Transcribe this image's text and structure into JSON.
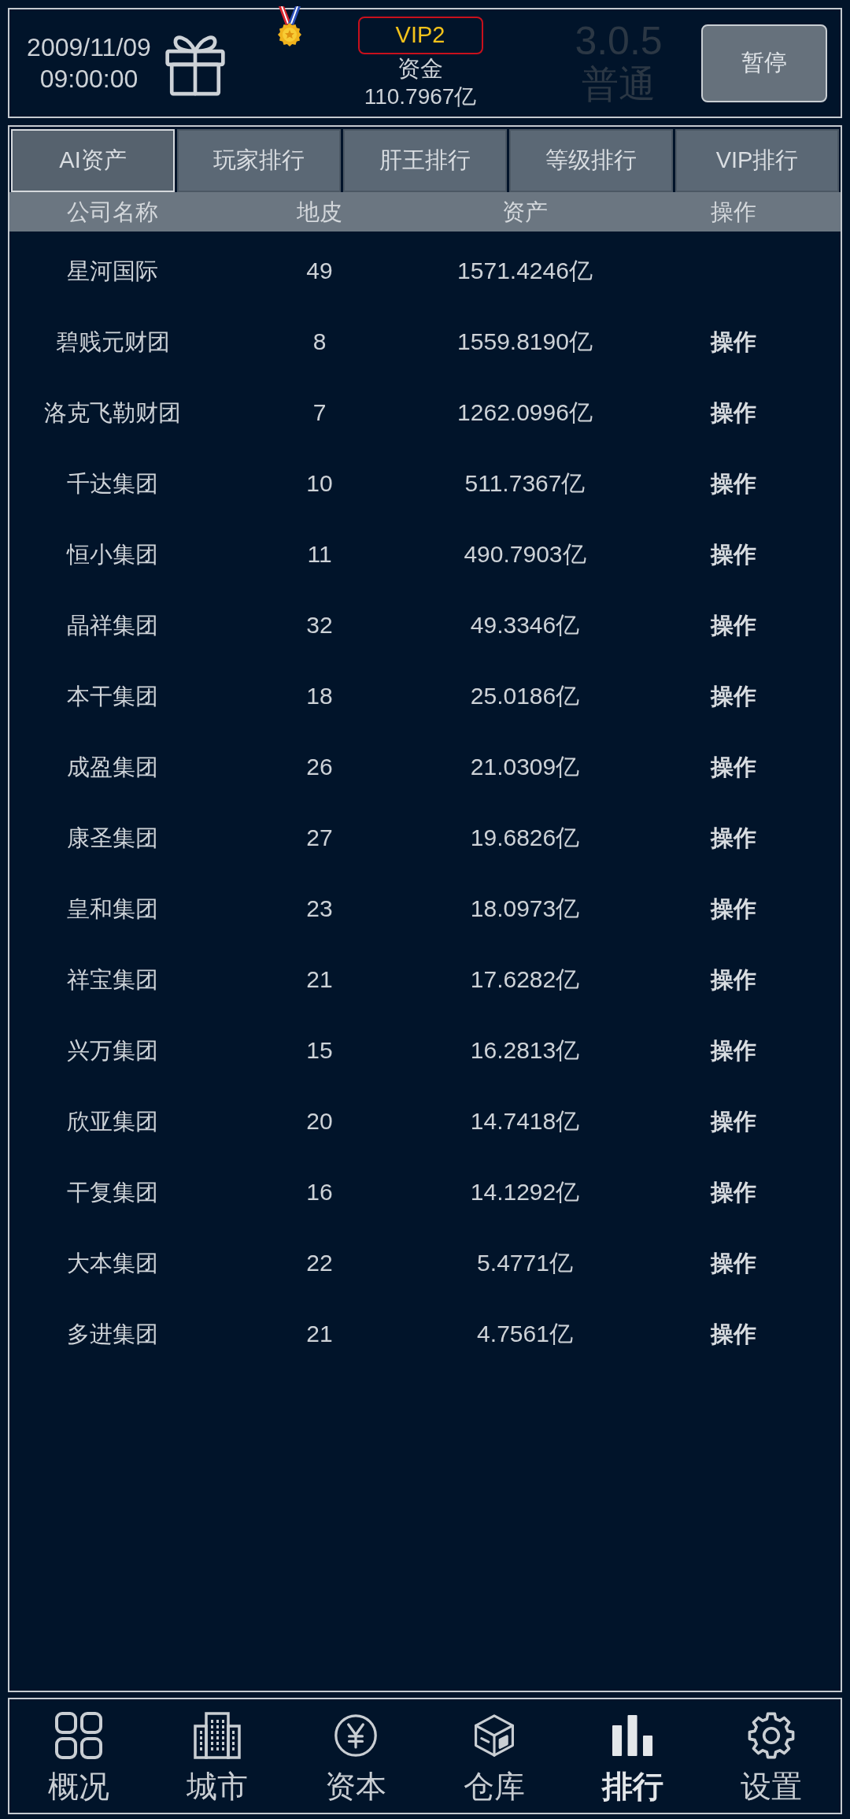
{
  "header": {
    "date": "2009/11/09",
    "time": "09:00:00",
    "vip_level": "VIP2",
    "funds_label": "资金",
    "funds_value": "110.7967亿",
    "version": "3.0.5",
    "mode": "普通",
    "pause_button": "暂停"
  },
  "tabs": [
    {
      "label": "AI资产",
      "selected": true
    },
    {
      "label": "玩家排行",
      "selected": false
    },
    {
      "label": "肝王排行",
      "selected": false
    },
    {
      "label": "等级排行",
      "selected": false
    },
    {
      "label": "VIP排行",
      "selected": false
    }
  ],
  "table": {
    "columns": [
      "公司名称",
      "地皮",
      "资产",
      "操作"
    ],
    "rows": [
      {
        "name": "星河国际",
        "land": "49",
        "assets": "1571.4246亿"
      },
      {
        "name": "碧贱元财团",
        "land": "8",
        "assets": "1559.8190亿",
        "action": "操作"
      },
      {
        "name": "洛克飞勒财团",
        "land": "7",
        "assets": "1262.0996亿",
        "action": "操作"
      },
      {
        "name": "千达集团",
        "land": "10",
        "assets": "511.7367亿",
        "action": "操作"
      },
      {
        "name": "恒小集团",
        "land": "11",
        "assets": "490.7903亿",
        "action": "操作"
      },
      {
        "name": "晶祥集团",
        "land": "32",
        "assets": "49.3346亿",
        "action": "操作"
      },
      {
        "name": "本干集团",
        "land": "18",
        "assets": "25.0186亿",
        "action": "操作"
      },
      {
        "name": "成盈集团",
        "land": "26",
        "assets": "21.0309亿",
        "action": "操作"
      },
      {
        "name": "康圣集团",
        "land": "27",
        "assets": "19.6826亿",
        "action": "操作"
      },
      {
        "name": "皇和集团",
        "land": "23",
        "assets": "18.0973亿",
        "action": "操作"
      },
      {
        "name": "祥宝集团",
        "land": "21",
        "assets": "17.6282亿",
        "action": "操作"
      },
      {
        "name": "兴万集团",
        "land": "15",
        "assets": "16.2813亿",
        "action": "操作"
      },
      {
        "name": "欣亚集团",
        "land": "20",
        "assets": "14.7418亿",
        "action": "操作"
      },
      {
        "name": "干复集团",
        "land": "16",
        "assets": "14.1292亿",
        "action": "操作"
      },
      {
        "name": "大本集团",
        "land": "22",
        "assets": "5.4771亿",
        "action": "操作"
      },
      {
        "name": "多进集团",
        "land": "21",
        "assets": "4.7561亿",
        "action": "操作"
      }
    ]
  },
  "bottom_nav": [
    {
      "label": "概况",
      "selected": false
    },
    {
      "label": "城市",
      "selected": false
    },
    {
      "label": "资本",
      "selected": false
    },
    {
      "label": "仓库",
      "selected": false
    },
    {
      "label": "排行",
      "selected": true
    },
    {
      "label": "设置",
      "selected": false
    }
  ]
}
